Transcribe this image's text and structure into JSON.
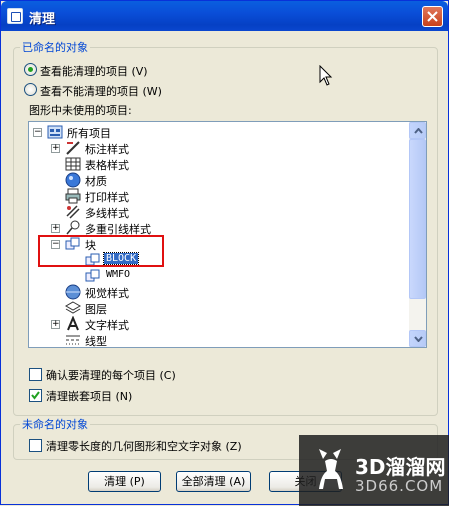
{
  "window": {
    "title": "清理"
  },
  "named_group": {
    "legend": "已命名的对象",
    "radio_view_purgeable": "查看能清理的项目 (V)",
    "radio_view_unpurgeable": "查看不能清理的项目 (W)",
    "tree_label": "图形中未使用的项目:"
  },
  "tree": {
    "root": "所有项目",
    "items": [
      "标注样式",
      "表格样式",
      "材质",
      "打印样式",
      "多线样式",
      "多重引线样式",
      "块",
      "BLOCK",
      "WMFO",
      "视觉样式",
      "图层",
      "文字样式",
      "线型"
    ]
  },
  "options": {
    "confirm_each": "确认要清理的每个项目 (C)",
    "confirm_each_checked": false,
    "purge_nested": "清理嵌套项目 (N)",
    "purge_nested_checked": true
  },
  "unnamed_group": {
    "legend": "未命名的对象",
    "zero_length": "清理零长度的几何图形和空文字对象 (Z)",
    "zero_length_checked": false
  },
  "buttons": {
    "purge": "清理 (P)",
    "purge_all": "全部清理 (A)",
    "close": "关闭"
  },
  "watermark": {
    "title": "3D溜溜网",
    "subtitle": "3D66.COM"
  }
}
